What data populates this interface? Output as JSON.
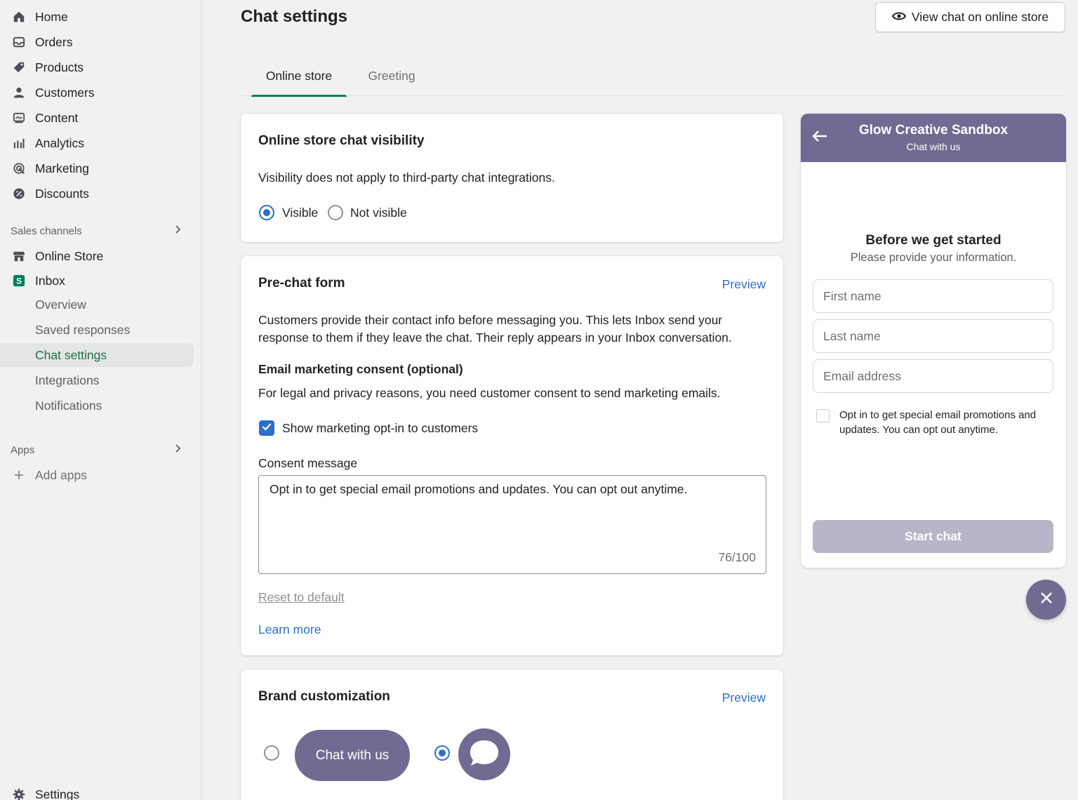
{
  "sidebar": {
    "nav": [
      {
        "label": "Home",
        "icon": "home-icon"
      },
      {
        "label": "Orders",
        "icon": "orders-icon"
      },
      {
        "label": "Products",
        "icon": "tag-icon"
      },
      {
        "label": "Customers",
        "icon": "person-icon"
      },
      {
        "label": "Content",
        "icon": "content-icon"
      },
      {
        "label": "Analytics",
        "icon": "bar-chart-icon"
      },
      {
        "label": "Marketing",
        "icon": "target-icon"
      },
      {
        "label": "Discounts",
        "icon": "discount-icon"
      }
    ],
    "sales_channels_label": "Sales channels",
    "channels": [
      {
        "label": "Online Store",
        "icon": "store-icon"
      },
      {
        "label": "Inbox",
        "icon": "inbox-app-icon"
      }
    ],
    "inbox_subitems": [
      "Overview",
      "Saved responses",
      "Chat settings",
      "Integrations",
      "Notifications"
    ],
    "apps_label": "Apps",
    "add_apps_label": "Add apps",
    "settings_label": "Settings"
  },
  "header": {
    "title": "Chat settings",
    "view_button": "View chat on online store"
  },
  "tabs": [
    {
      "label": "Online store",
      "active": true
    },
    {
      "label": "Greeting",
      "active": false
    }
  ],
  "visibility_card": {
    "title": "Online store chat visibility",
    "description": "Visibility does not apply to third-party chat integrations.",
    "option_visible": "Visible",
    "option_not_visible": "Not visible",
    "selected": "Visible"
  },
  "prechat_card": {
    "title": "Pre-chat form",
    "preview_link": "Preview",
    "description_line1": "Customers provide their contact info before messaging you. This lets Inbox send your",
    "description_line2": "response to them if they leave the chat. Their reply appears in your Inbox conversation.",
    "consent_heading": "Email marketing consent (optional)",
    "consent_description": "For legal and privacy reasons, you need customer consent to send marketing emails.",
    "checkbox_label": "Show marketing opt-in to customers",
    "checkbox_checked": true,
    "consent_message_label": "Consent message",
    "consent_message_value": "Opt in to get special email promotions and updates. You can opt out anytime.",
    "char_count": "76/100",
    "reset_link": "Reset to default",
    "learn_more_link": "Learn more"
  },
  "brand_card": {
    "title": "Brand customization",
    "preview_link": "Preview",
    "button_option_label": "Chat with us",
    "selected": "icon"
  },
  "chat_preview": {
    "store_name": "Glow Creative Sandbox",
    "subtitle": "Chat with us",
    "heading": "Before we get started",
    "subheading": "Please provide your information.",
    "first_name_placeholder": "First name",
    "last_name_placeholder": "Last name",
    "email_placeholder": "Email address",
    "optin_line1": "Opt in to get special email promotions and",
    "optin_line2": "updates. You can opt out anytime.",
    "start_button": "Start chat",
    "accent_color": "#716a93"
  }
}
